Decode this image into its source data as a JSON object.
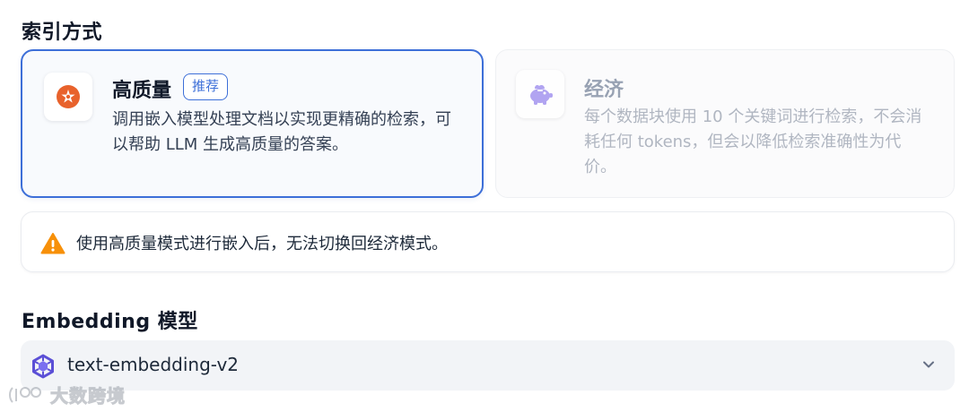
{
  "index_section": {
    "title": "索引方式",
    "high_quality": {
      "title": "高质量",
      "badge": "推荐",
      "description": "调用嵌入模型处理文档以实现更精确的检索，可以帮助 LLM 生成高质量的答案。",
      "selected": true,
      "icon": "sparkle-badge-icon"
    },
    "economy": {
      "title": "经济",
      "description": "每个数据块使用 10 个关键词进行检索，不会消耗任何 tokens，但会以降低检索准确性为代价。",
      "selected": false,
      "icon": "piggy-bank-icon"
    },
    "warning": {
      "text": "使用高质量模式进行嵌入后，无法切换回经济模式。",
      "icon": "warning-icon"
    }
  },
  "embedding_section": {
    "title": "Embedding 模型",
    "selected_model": "text-embedding-v2",
    "model_icon": "tongyi-model-icon",
    "dropdown_icon": "chevron-down-icon"
  },
  "watermark": {
    "text": "大数跨境"
  },
  "colors": {
    "accent": "#3d6fd8",
    "high_quality_icon": "#e8622c",
    "economy_icon": "#a596f0",
    "warning": "#f79009"
  }
}
